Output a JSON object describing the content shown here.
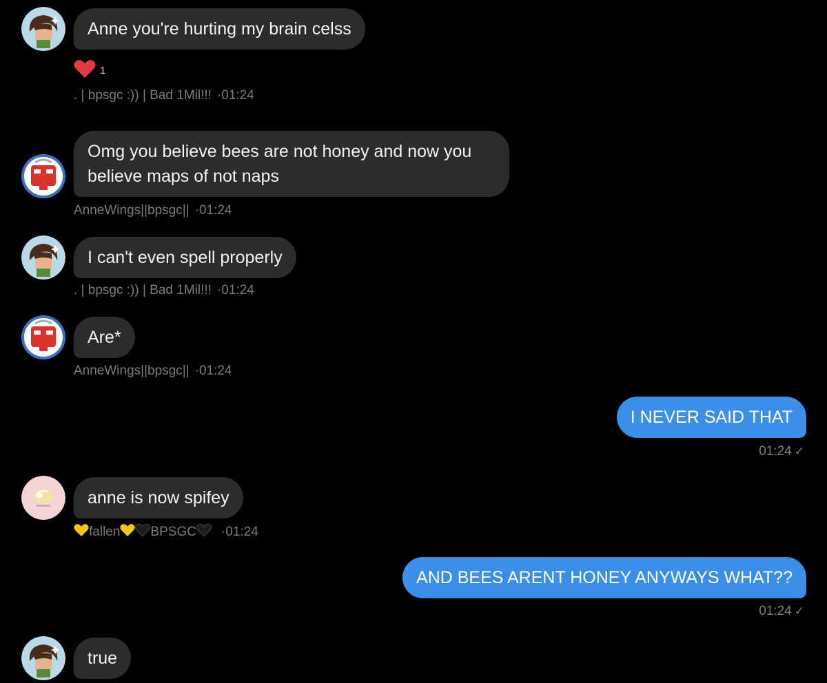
{
  "messages": [
    {
      "text": "Anne you're hurting my brain celss",
      "reaction_count": "1",
      "sender": ". | bpsgc :)) | Bad 1Mil!!!",
      "time": "01:24"
    },
    {
      "text": "Omg you believe bees are not honey and now you believe maps of not naps",
      "sender": "AnneWings||bpsgc||",
      "time": "01:24"
    },
    {
      "text": "I can't even spell properly",
      "sender": ". | bpsgc :)) | Bad 1Mil!!!",
      "time": "01:24"
    },
    {
      "text": "Are*",
      "sender": "AnneWings||bpsgc||",
      "time": "01:24"
    },
    {
      "text": "I NEVER SAID THAT",
      "time": "01:24"
    },
    {
      "text": "anne is now spifey",
      "sender_part1": "fallen",
      "sender_part2": "BPSGC",
      "time": "01:24"
    },
    {
      "text": "AND BEES ARENT HONEY ANYWAYS WHAT??",
      "time": "01:24"
    },
    {
      "text": "true"
    }
  ],
  "colors": {
    "background": "#000000",
    "incoming_bubble": "#2b2c2e",
    "outgoing_bubble": "#3b8fe8",
    "meta_text": "#7b7b80"
  },
  "icons": {
    "reaction": "heart-icon",
    "read_receipt": "check-icon"
  }
}
